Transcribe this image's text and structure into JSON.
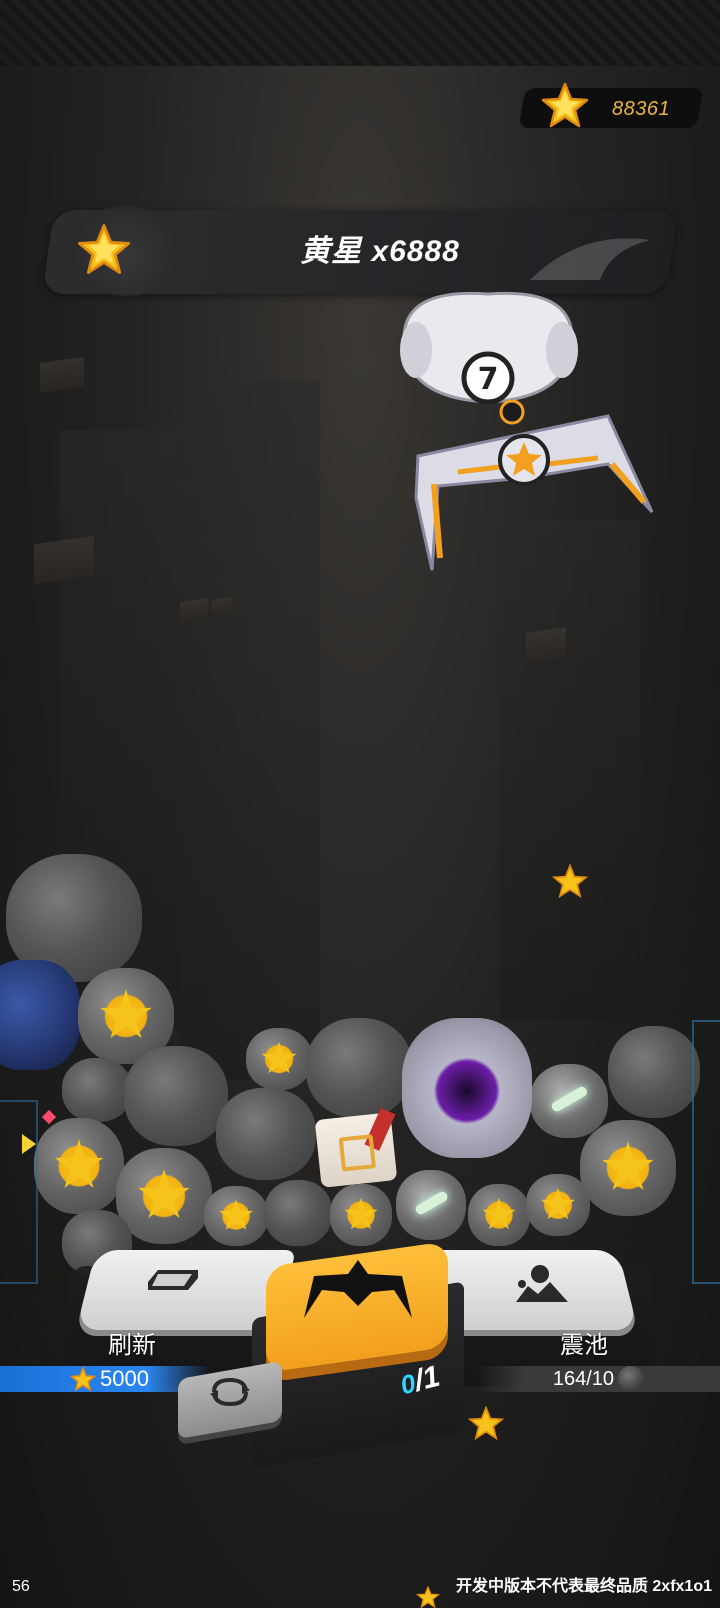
{
  "hud": {
    "currency_icon": "gold-star-icon",
    "currency_value": "88361"
  },
  "banner": {
    "icon": "gold-star-icon",
    "reward_text": "黄星 x6888"
  },
  "controls": {
    "refresh_label": "刷新",
    "refresh_cost": "5000",
    "grab_current": "0",
    "grab_separator": "/",
    "grab_total": "1",
    "shake_label": "震池",
    "shake_pool": "164/10"
  },
  "footer": {
    "fps": "56",
    "build_note": "开发中版本不代表最终品质 2xfx1o1"
  },
  "colors": {
    "gold": "#f6c31a",
    "accent_orange": "#f2a01e",
    "cost_blue": "#1b6fd6",
    "count_cyan": "#2bd6ff"
  }
}
